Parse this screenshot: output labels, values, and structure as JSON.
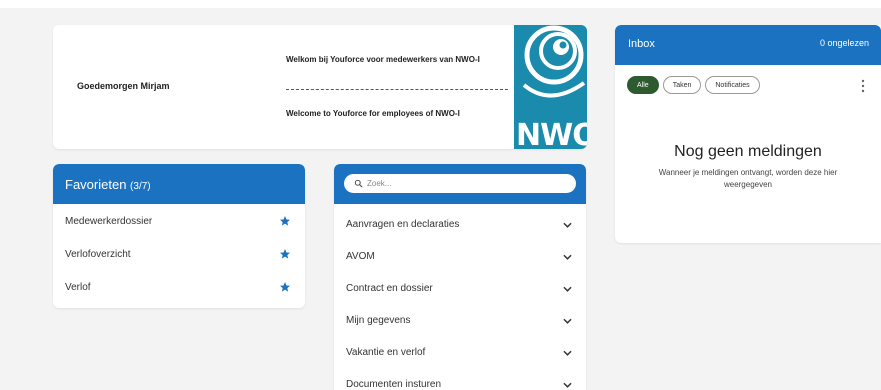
{
  "welcome": {
    "greeting": "Goedemorgen Mirjam",
    "text_nl": "Welkom bij Youforce voor medewerkers van NWO-I",
    "text_en": "Welcome to Youforce for employees of NWO-I",
    "logo_text": "NWO"
  },
  "favorites": {
    "title": "Favorieten",
    "count": "(3/7)",
    "items": [
      {
        "label": "Medewerkerdossier",
        "icon": "star-icon"
      },
      {
        "label": "Verlofoverzicht",
        "icon": "star-icon"
      },
      {
        "label": "Verlof",
        "icon": "star-icon"
      }
    ]
  },
  "menu": {
    "search_placeholder": "Zoek...",
    "items": [
      {
        "label": "Aanvragen en declaraties"
      },
      {
        "label": "AVOM"
      },
      {
        "label": "Contract en dossier"
      },
      {
        "label": "Mijn gegevens"
      },
      {
        "label": "Vakantie en verlof"
      },
      {
        "label": "Documenten insturen"
      }
    ]
  },
  "inbox": {
    "title": "Inbox",
    "unread": "0 ongelezen",
    "filters": [
      "Alle",
      "Taken",
      "Notificaties"
    ],
    "active_filter": "Alle",
    "empty_title": "Nog geen meldingen",
    "empty_subtitle": "Wanneer je meldingen ontvangt, worden deze hier weergegeven"
  },
  "colors": {
    "header_blue": "#1a72c0",
    "logo_blue": "#1a8aad",
    "active_pill": "#2d5a2e"
  }
}
